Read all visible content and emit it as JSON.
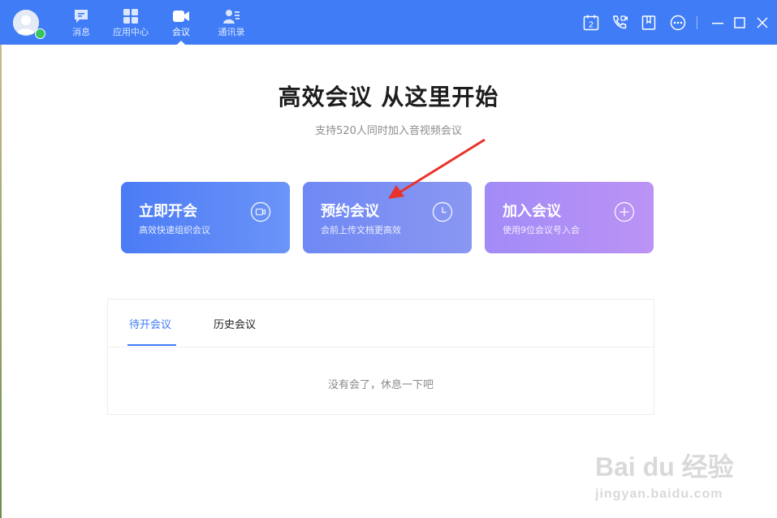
{
  "colors": {
    "topbar": "#3f7cf6",
    "accent": "#3f7cf6",
    "card_instant": "#4b7bf5",
    "card_schedule": "#7b8ff3",
    "card_join": "#ae8ff5",
    "arrow": "#e8332b"
  },
  "nav": {
    "items": [
      {
        "label": "消息",
        "icon": "message-icon"
      },
      {
        "label": "应用中心",
        "icon": "app-center-icon"
      },
      {
        "label": "会议",
        "icon": "meeting-video-icon",
        "active": true
      },
      {
        "label": "通讯录",
        "icon": "contacts-icon"
      }
    ]
  },
  "toolbar": {
    "calendar_badge": "2",
    "icons": [
      "calendar-icon",
      "phone-video-icon",
      "bookmark-icon",
      "more-icon",
      "minimize-icon",
      "maximize-icon",
      "close-icon"
    ]
  },
  "main": {
    "title": "高效会议 从这里开始",
    "subtitle": "支持520人同时加入音视频会议",
    "cards": [
      {
        "title": "立即开会",
        "subtitle": "高效快速组织会议",
        "icon": "video-icon"
      },
      {
        "title": "预约会议",
        "subtitle": "会前上传文档更高效",
        "icon": "clock-icon"
      },
      {
        "title": "加入会议",
        "subtitle": "使用9位会议号入会",
        "icon": "plus-circle-icon"
      }
    ]
  },
  "meetings": {
    "tabs": [
      {
        "label": "待开会议",
        "active": true
      },
      {
        "label": "历史会议"
      }
    ],
    "empty_text": "没有会了，休息一下吧"
  },
  "watermark": {
    "line1": "Bai du 经验",
    "line2": "jingyan.baidu.com"
  }
}
